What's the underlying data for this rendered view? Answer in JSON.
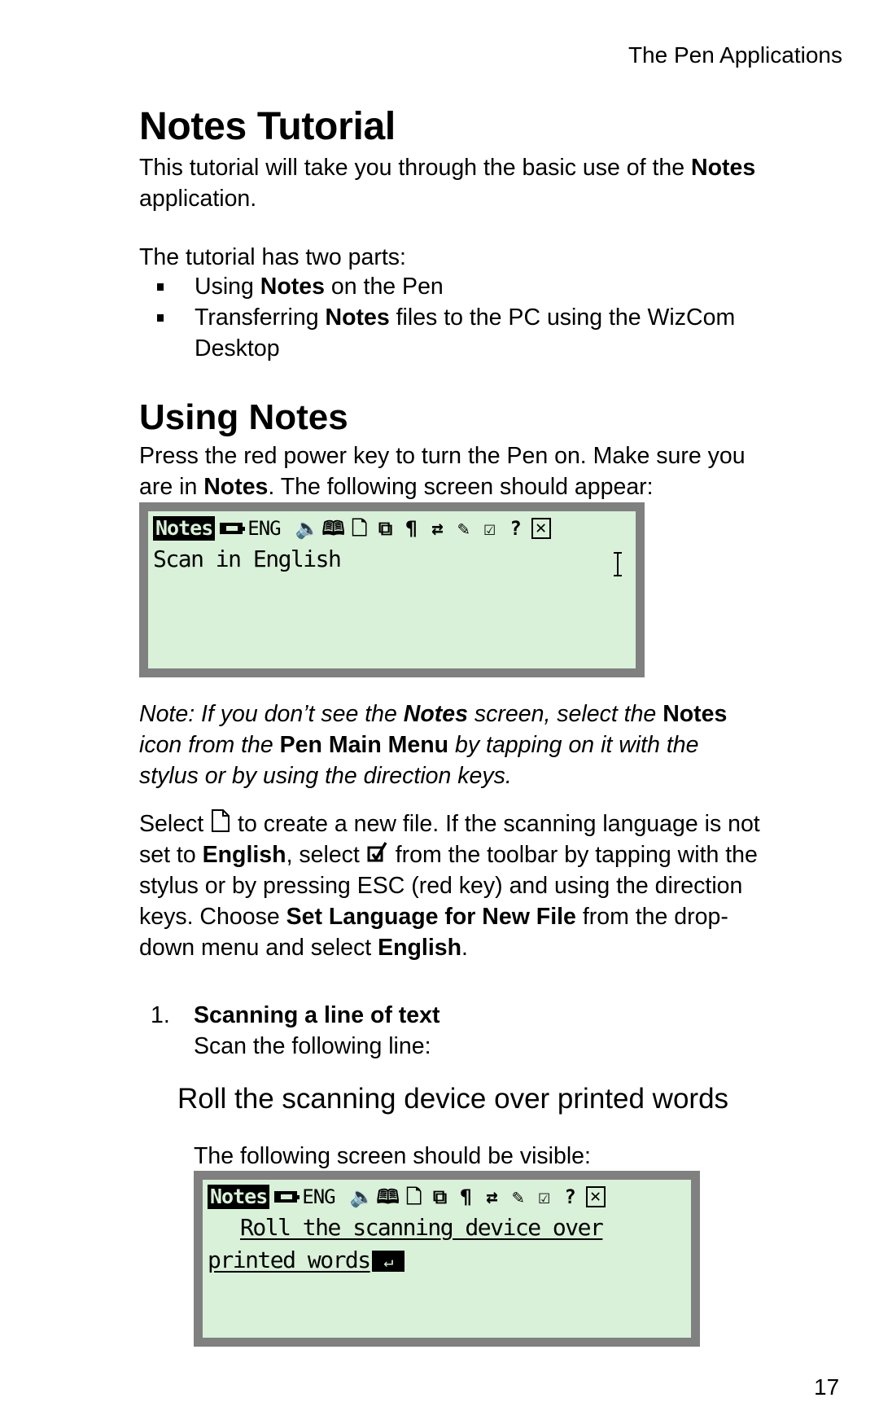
{
  "running_head": "The Pen Applications",
  "title": "Notes Tutorial",
  "intro": {
    "part1": "This tutorial will take you through the basic use of the ",
    "bold1": "Notes",
    "line2": "application."
  },
  "parts_intro": "The tutorial has two parts:",
  "bullets": [
    {
      "pre": "Using ",
      "bold": "Notes",
      "post": " on the Pen"
    },
    {
      "pre": "Transferring ",
      "bold": "Notes",
      "post": " files to the PC using the WizCom",
      "line2": "Desktop"
    }
  ],
  "section": {
    "heading": "Using Notes",
    "p1_a": "Press the red power key to turn the Pen on. Make sure you",
    "p1_b": "are in ",
    "p1_bold": "Notes",
    "p1_c": ". The following screen should appear:"
  },
  "lcd_common": {
    "app_title": "Notes",
    "language": "ENG",
    "toolbar_icons": [
      {
        "name": "speaker-icon",
        "glyph": "🔈"
      },
      {
        "name": "dictionary-icon",
        "glyph": "🕮"
      },
      {
        "name": "new-file-icon",
        "glyph": "🗋"
      },
      {
        "name": "copy-icon",
        "glyph": "⧉"
      },
      {
        "name": "paragraph-icon",
        "glyph": "¶"
      },
      {
        "name": "swap-icon",
        "glyph": "⇄"
      },
      {
        "name": "pencil-icon",
        "glyph": "✎"
      },
      {
        "name": "checkbox-icon",
        "glyph": "☑"
      },
      {
        "name": "help-icon",
        "glyph": "?"
      },
      {
        "name": "close-icon",
        "glyph": "✕"
      }
    ]
  },
  "lcd1": {
    "text": "Scan in English"
  },
  "note": {
    "a": "Note: If you don’t see the ",
    "b_bold_italic": "Notes",
    "c": " screen, select the ",
    "d_bold": "Notes",
    "e": "icon from the ",
    "f_bold": "Pen Main Menu",
    "g": " by tapping on it with the",
    "h": "stylus or by using the direction keys."
  },
  "select_para": {
    "a": "Select",
    "b": " to create a new file. If the scanning language is not",
    "c": "set to ",
    "d_bold": "English",
    "e": ", select",
    "f": " from the toolbar by tapping with the",
    "g": "stylus or by pressing ESC (red key) and using the direction",
    "h": "keys. Choose ",
    "i_bold": "Set Language for New File",
    "j": " from the drop-",
    "k": "down menu and select ",
    "l_bold": "English",
    "m": "."
  },
  "step1": {
    "number": "1.",
    "heading": "Scanning a line of text",
    "instruction": "Scan the following line:",
    "sample": "Roll the scanning device over printed words",
    "visible_intro": "The following screen should be visible:"
  },
  "lcd2": {
    "line1": "Roll the scanning device over",
    "line2": "printed words"
  },
  "page_number": "17"
}
